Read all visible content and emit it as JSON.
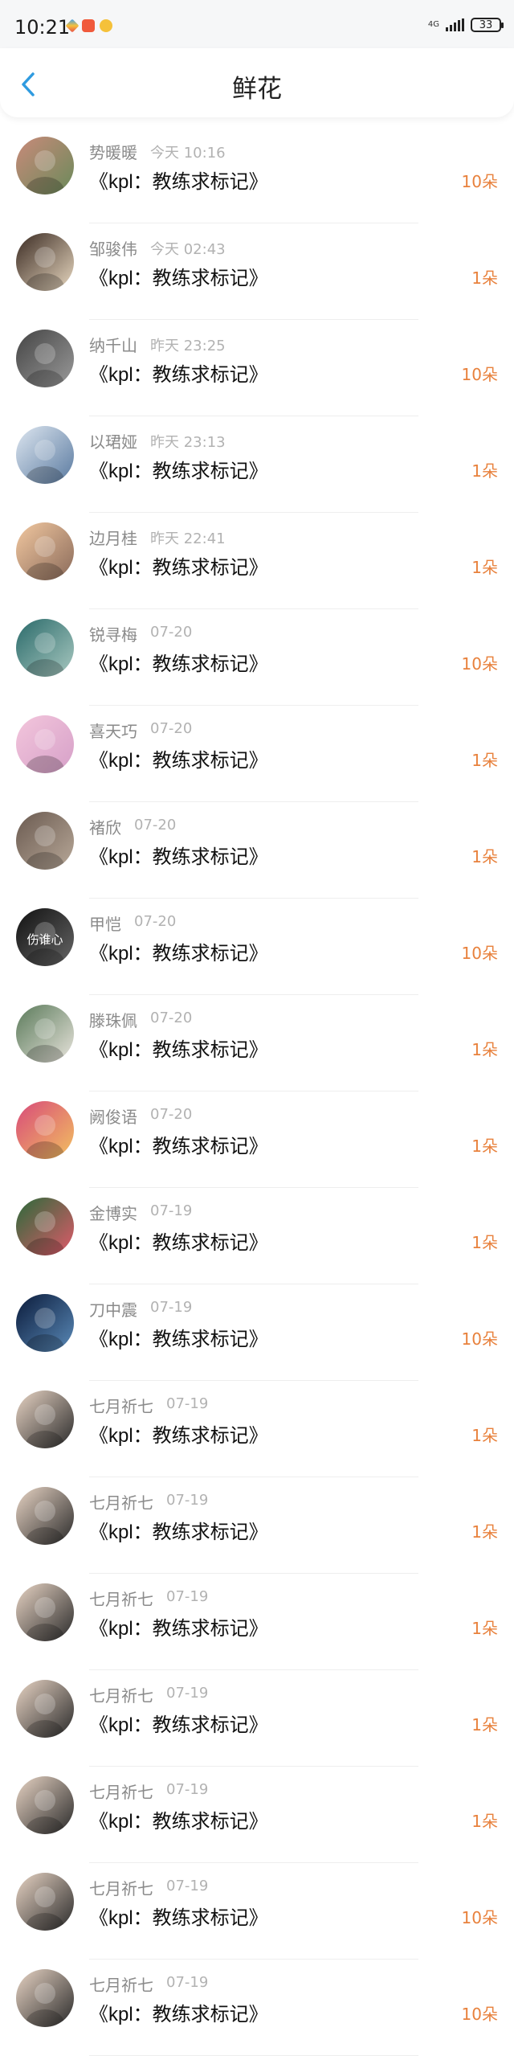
{
  "status_bar": {
    "time": "10:21",
    "network": "4G",
    "battery": "33"
  },
  "header": {
    "title": "鲜花",
    "back_icon": "chevron-left-icon"
  },
  "colors": {
    "accent_blue": "#2f9be0",
    "count_orange": "#e8813c"
  },
  "flowers": [
    {
      "name": "势暖暖",
      "time": "今天 10:16",
      "title": "《kpl：教练求标记》",
      "count": "10朵"
    },
    {
      "name": "邹骏伟",
      "time": "今天 02:43",
      "title": "《kpl：教练求标记》",
      "count": "1朵"
    },
    {
      "name": "纳千山",
      "time": "昨天 23:25",
      "title": "《kpl：教练求标记》",
      "count": "10朵"
    },
    {
      "name": "以珺娅",
      "time": "昨天 23:13",
      "title": "《kpl：教练求标记》",
      "count": "1朵"
    },
    {
      "name": "边月桂",
      "time": "昨天 22:41",
      "title": "《kpl：教练求标记》",
      "count": "1朵"
    },
    {
      "name": "锐寻梅",
      "time": "07-20",
      "title": "《kpl：教练求标记》",
      "count": "10朵"
    },
    {
      "name": "喜天巧",
      "time": "07-20",
      "title": "《kpl：教练求标记》",
      "count": "1朵"
    },
    {
      "name": "褚欣",
      "time": "07-20",
      "title": "《kpl：教练求标记》",
      "count": "1朵"
    },
    {
      "name": "甲恺",
      "time": "07-20",
      "title": "《kpl：教练求标记》",
      "count": "10朵",
      "avatar_text": "伤谁心"
    },
    {
      "name": "滕珠佩",
      "time": "07-20",
      "title": "《kpl：教练求标记》",
      "count": "1朵"
    },
    {
      "name": "阙俊语",
      "time": "07-20",
      "title": "《kpl：教练求标记》",
      "count": "1朵"
    },
    {
      "name": "金博实",
      "time": "07-19",
      "title": "《kpl：教练求标记》",
      "count": "1朵"
    },
    {
      "name": "刀中震",
      "time": "07-19",
      "title": "《kpl：教练求标记》",
      "count": "10朵"
    },
    {
      "name": "七月祈七",
      "time": "07-19",
      "title": "《kpl：教练求标记》",
      "count": "1朵"
    },
    {
      "name": "七月祈七",
      "time": "07-19",
      "title": "《kpl：教练求标记》",
      "count": "1朵"
    },
    {
      "name": "七月祈七",
      "time": "07-19",
      "title": "《kpl：教练求标记》",
      "count": "1朵"
    },
    {
      "name": "七月祈七",
      "time": "07-19",
      "title": "《kpl：教练求标记》",
      "count": "1朵"
    },
    {
      "name": "七月祈七",
      "time": "07-19",
      "title": "《kpl：教练求标记》",
      "count": "1朵"
    },
    {
      "name": "七月祈七",
      "time": "07-19",
      "title": "《kpl：教练求标记》",
      "count": "10朵"
    },
    {
      "name": "七月祈七",
      "time": "07-19",
      "title": "《kpl：教练求标记》",
      "count": "10朵"
    }
  ]
}
